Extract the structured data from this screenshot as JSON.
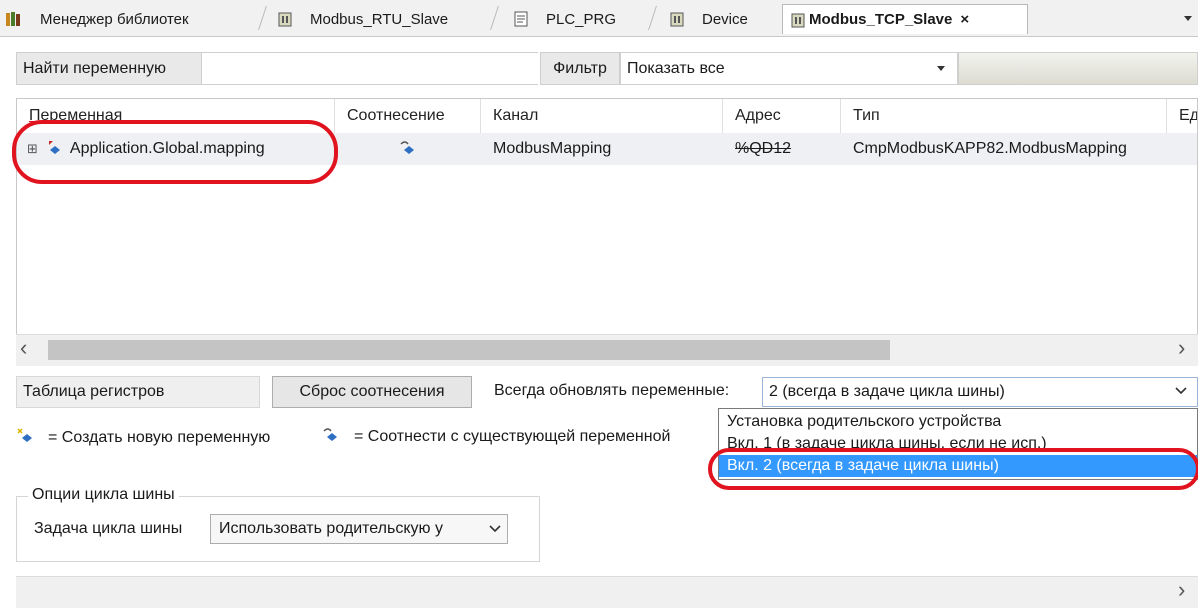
{
  "tabs": [
    {
      "label": "Менеджер библиотек",
      "icon": "library-icon"
    },
    {
      "label": "Modbus_RTU_Slave",
      "icon": "device-icon"
    },
    {
      "label": "PLC_PRG",
      "icon": "program-icon"
    },
    {
      "label": "Device",
      "icon": "device-icon"
    },
    {
      "label": "Modbus_TCP_Slave",
      "icon": "device-icon",
      "active": true
    }
  ],
  "tab_close": "×",
  "search": {
    "find_label": "Найти переменную",
    "filter_label": "Фильтр",
    "filter_value": "Показать все"
  },
  "grid": {
    "columns": [
      "Переменная",
      "Соотнесение",
      "Канал",
      "Адрес",
      "Тип",
      "Ед"
    ],
    "rows": [
      {
        "expander": "⊞",
        "variable": "Application.Global.mapping",
        "mapping_icon": "map-existing-icon",
        "channel": "ModbusMapping",
        "address": "%QD12",
        "type": "CmpModbusKAPP82.ModbusMapping"
      }
    ]
  },
  "scroll": {
    "left": "‹",
    "right": "›"
  },
  "controls": {
    "register_table": "Таблица регистров",
    "reset_mapping": "Сброс соотнесения",
    "always_update_label": "Всегда обновлять переменные:",
    "always_update_value": "2 (всегда в задаче цикла шины)"
  },
  "dropdown": {
    "options": [
      "Установка родительского устройства",
      "Вкл. 1 (в задаче цикла шины, если не исп.)",
      "Вкл. 2 (всегда в задаче цикла шины)"
    ],
    "selected_index": 2
  },
  "legend": {
    "create_text": "= Создать новую переменную",
    "map_text": "= Соотнести с существующей переменной"
  },
  "bus_cycle": {
    "group_title": "Опции цикла шины",
    "task_label": "Задача цикла шины",
    "task_value": "Использовать родительскую у"
  },
  "colors": {
    "annotation": "#e0131f",
    "selection": "#3399ff"
  }
}
